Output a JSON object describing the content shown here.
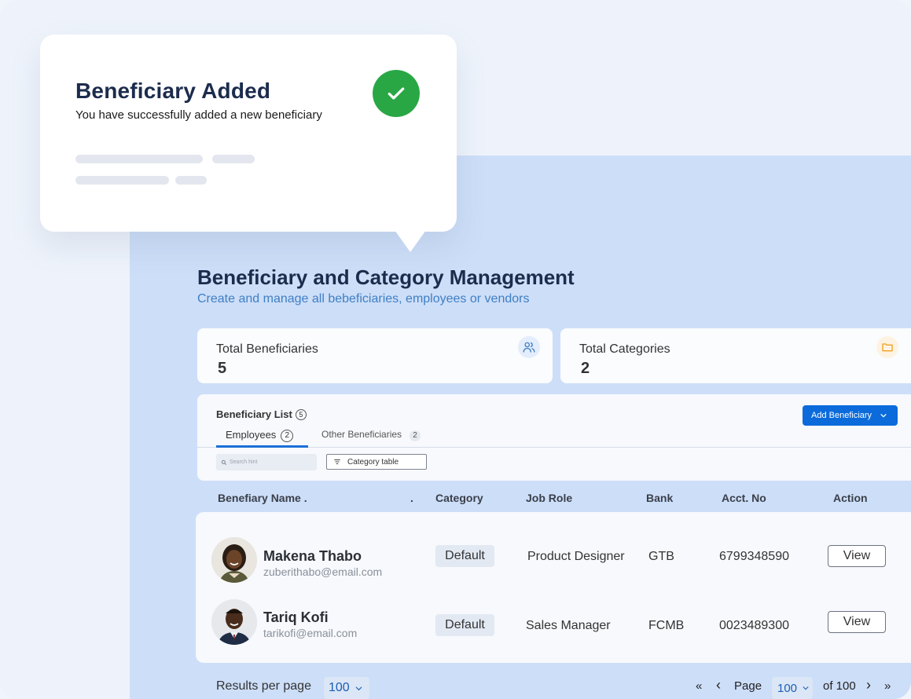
{
  "toast": {
    "title": "Beneficiary Added",
    "message": "You have successfully added a new beneficiary"
  },
  "page": {
    "title": "Beneficiary and Category Management",
    "subtitle": "Create and manage all bebeficiaries, employees or vendors"
  },
  "stats": [
    {
      "label": "Total Beneficiaries",
      "value": "5",
      "icon": "users-icon"
    },
    {
      "label": "Total Categories",
      "value": "2",
      "icon": "folder-icon"
    }
  ],
  "list": {
    "title": "Beneficiary List",
    "count": "5",
    "add_button": "Add Beneficiary",
    "tabs": [
      {
        "label": "Employees",
        "count": "2"
      },
      {
        "label": "Other Beneficiaries",
        "count": "2"
      }
    ],
    "search_placeholder": "Search hint",
    "filter_label": "Category table"
  },
  "table": {
    "headers": [
      "Benefiary Name .",
      ".",
      "Category",
      "Job Role",
      "Bank",
      "Acct. No",
      "Action"
    ],
    "rows": [
      {
        "name": "Makena Thabo",
        "email": "zuberithabo@email.com",
        "category": "Default",
        "job_role": "Product Designer",
        "bank": "GTB",
        "acct_no": "6799348590",
        "action": "View"
      },
      {
        "name": "Tariq Kofi",
        "email": "tarikofi@email.com",
        "category": "Default",
        "job_role": "Sales Manager",
        "bank": "FCMB",
        "acct_no": "0023489300",
        "action": "View"
      }
    ]
  },
  "footer": {
    "results_label": "Results per page",
    "results_value": "100",
    "page_label": "Page",
    "page_value": "100",
    "of_label": "of 100",
    "first": "«",
    "prev": "‹",
    "next": "›",
    "last": "»"
  },
  "colors": {
    "accent": "#0b6bdb",
    "success": "#2aa745",
    "title": "#1c2c4d",
    "stage": "#cddef8"
  }
}
